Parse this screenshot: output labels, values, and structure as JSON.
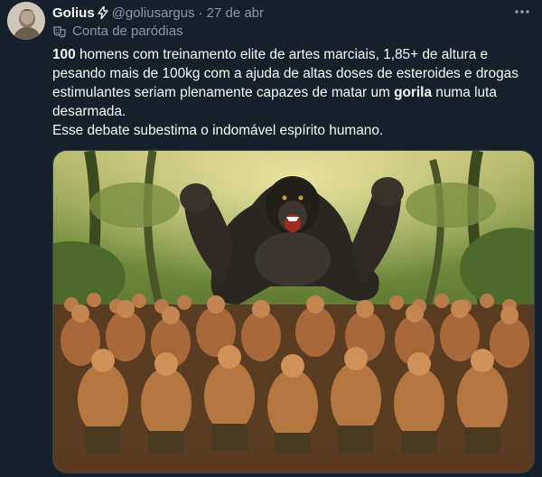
{
  "author": {
    "display_name": "Golius",
    "badge_icon": "lightning-bolt-icon",
    "handle": "@goliusargus",
    "separator": "·",
    "timestamp": "27 de abr",
    "parody_label": "Conta de paródias",
    "parody_icon": "theater-masks-icon"
  },
  "menu_icon": "more-horizontal-icon",
  "tweet": {
    "bold_number": "100",
    "text_part1": " homens com treinamento elite de artes marciais, 1,85+ de altura e pesando mais de 100kg com a ajuda de altas doses de esteroides e drogas estimulantes seriam plenamente capazes de matar um ",
    "bold_word": "gorila",
    "text_part2": " numa luta desarmada.",
    "line2": "Esse debate subestima o indomável espírito humano."
  },
  "media": {
    "alt": "painting of a gorilla surrounded by many shirtless men in a jungle"
  },
  "colors": {
    "background": "#15202b",
    "text": "#f7f9f9",
    "secondary": "#8b98a5"
  }
}
